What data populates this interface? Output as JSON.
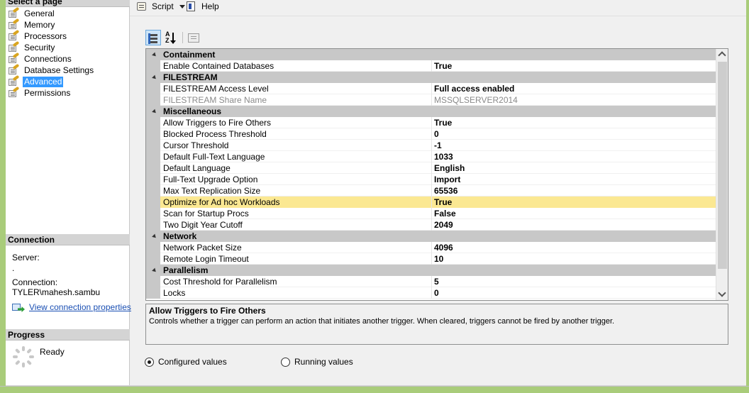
{
  "left_panel": {
    "select_page_title": "Select a page",
    "pages": [
      {
        "label": "General",
        "selected": false
      },
      {
        "label": "Memory",
        "selected": false
      },
      {
        "label": "Processors",
        "selected": false
      },
      {
        "label": "Security",
        "selected": false
      },
      {
        "label": "Connections",
        "selected": false
      },
      {
        "label": "Database Settings",
        "selected": false
      },
      {
        "label": "Advanced",
        "selected": true
      },
      {
        "label": "Permissions",
        "selected": false
      }
    ],
    "connection": {
      "title": "Connection",
      "server_label": "Server:",
      "server_value": ".",
      "connection_label": "Connection:",
      "connection_value": "TYLER\\mahesh.sambu",
      "link_text": "View connection properties"
    },
    "progress": {
      "title": "Progress",
      "status": "Ready"
    }
  },
  "toolbar": {
    "script_label": "Script",
    "help_label": "Help"
  },
  "property_grid": {
    "selected_property": "Optimize for Ad hoc Workloads",
    "rows": [
      {
        "type": "category",
        "name": "Containment"
      },
      {
        "type": "property",
        "name": "Enable Contained Databases",
        "value": "True"
      },
      {
        "type": "category",
        "name": "FILESTREAM"
      },
      {
        "type": "property",
        "name": "FILESTREAM Access Level",
        "value": "Full access enabled"
      },
      {
        "type": "property",
        "name": "FILESTREAM Share Name",
        "value": "MSSQLSERVER2014",
        "disabled": true
      },
      {
        "type": "category",
        "name": "Miscellaneous"
      },
      {
        "type": "property",
        "name": "Allow Triggers to Fire Others",
        "value": "True"
      },
      {
        "type": "property",
        "name": "Blocked Process Threshold",
        "value": "0"
      },
      {
        "type": "property",
        "name": "Cursor Threshold",
        "value": "-1"
      },
      {
        "type": "property",
        "name": "Default Full-Text Language",
        "value": "1033"
      },
      {
        "type": "property",
        "name": "Default Language",
        "value": "English"
      },
      {
        "type": "property",
        "name": "Full-Text Upgrade Option",
        "value": "Import"
      },
      {
        "type": "property",
        "name": "Max Text Replication Size",
        "value": "65536"
      },
      {
        "type": "property",
        "name": "Optimize for Ad hoc Workloads",
        "value": "True",
        "selected": true
      },
      {
        "type": "property",
        "name": "Scan for Startup Procs",
        "value": "False"
      },
      {
        "type": "property",
        "name": "Two Digit Year Cutoff",
        "value": "2049"
      },
      {
        "type": "category",
        "name": "Network"
      },
      {
        "type": "property",
        "name": "Network Packet Size",
        "value": "4096"
      },
      {
        "type": "property",
        "name": "Remote Login Timeout",
        "value": "10"
      },
      {
        "type": "category",
        "name": "Parallelism"
      },
      {
        "type": "property",
        "name": "Cost Threshold for Parallelism",
        "value": "5"
      },
      {
        "type": "property",
        "name": "Locks",
        "value": "0"
      }
    ]
  },
  "description": {
    "title": "Allow Triggers to Fire Others",
    "text": "Controls whether a trigger can perform an action that initiates another trigger. When cleared, triggers cannot be fired by another trigger."
  },
  "value_mode": {
    "configured_label": "Configured values",
    "running_label": "Running values",
    "selected": "configured"
  },
  "colors": {
    "selection_blue": "#3399ff",
    "highlight_yellow": "#fbe892",
    "category_gray": "#c8c8c8",
    "link_blue": "#1a4fb3"
  }
}
